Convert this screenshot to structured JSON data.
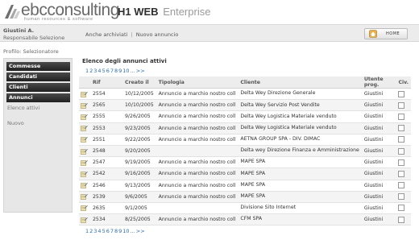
{
  "header": {
    "brand_main": "ebcconsulting",
    "brand_sub": "human resources & software",
    "product_bold": "H1 WEB",
    "product_light": "Enterprise"
  },
  "user": {
    "name": "Giustini A.",
    "role": "Responsabile Selezione"
  },
  "top_links": {
    "archived": "Anche archiviati",
    "separator": "|",
    "new_ad": "Nuovo annuncio"
  },
  "home_button": {
    "label": "HOME"
  },
  "profile": "Profilo: Selezionatore",
  "sidebar": {
    "items": [
      {
        "label": "Commesse"
      },
      {
        "label": "Candidati"
      },
      {
        "label": "Clienti"
      },
      {
        "label": "Annunci"
      }
    ],
    "subitems": [
      {
        "label": "Elenco attivi"
      },
      {
        "label": "Nuovo"
      }
    ]
  },
  "main": {
    "title": "Elenco degli annunci attivi",
    "pager": [
      "1",
      "2",
      "3",
      "4",
      "5",
      "6",
      "7",
      "8",
      "9",
      "10",
      "...",
      ">>"
    ],
    "columns": [
      "Rif",
      "Creato il",
      "Tipologia",
      "Cliente",
      "Utente prog.",
      "Civ."
    ],
    "rows": [
      {
        "rif": "2554",
        "date": "10/12/2005",
        "type": "Annuncio a marchio nostro coll",
        "client": "Delta Wey Direzione Generale",
        "user": "Giustini"
      },
      {
        "rif": "2565",
        "date": "10/10/2005",
        "type": "Annuncio a marchio nostro coll",
        "client": "Delta Wey Servizio Post Vendite",
        "user": "Giustini"
      },
      {
        "rif": "2555",
        "date": "9/26/2005",
        "type": "Annuncio a marchio nostro coll",
        "client": "Delta Wey Logistica Materiale venduto",
        "user": "Giustini"
      },
      {
        "rif": "2553",
        "date": "9/23/2005",
        "type": "Annuncio a marchio nostro coll",
        "client": "Delta Wey Logistica Materiale venduto",
        "user": "Giustini"
      },
      {
        "rif": "2551",
        "date": "9/22/2005",
        "type": "Annuncio a marchio nostro coll",
        "client": "AETNA GROUP SPA - DIV. DIMAC",
        "user": "Giustini"
      },
      {
        "rif": "2548",
        "date": "9/20/2005",
        "type": "",
        "client": "Delta wey Direzione Finanza e Amministrazione",
        "user": "Giustini"
      },
      {
        "rif": "2547",
        "date": "9/19/2005",
        "type": "Annuncio a marchio nostro coll",
        "client": "MAPE SPA",
        "user": "Giustini"
      },
      {
        "rif": "2542",
        "date": "9/16/2005",
        "type": "Annuncio a marchio nostro coll",
        "client": "MAPE SPA",
        "user": "Giustini"
      },
      {
        "rif": "2546",
        "date": "9/13/2005",
        "type": "Annuncio a marchio nostro coll",
        "client": "MAPE SPA",
        "user": "Giustini"
      },
      {
        "rif": "2539",
        "date": "9/6/2005",
        "type": "Annuncio a marchio nostro coll",
        "client": "MAPE SPA",
        "user": "Giustini"
      },
      {
        "rif": "2635",
        "date": "9/1/2005",
        "type": "",
        "client": "Divisione Sito Internet",
        "user": "Giustini"
      },
      {
        "rif": "2534",
        "date": "8/25/2005",
        "type": "Annuncio a marchio nostro coll",
        "client": "CFM SPA",
        "user": "Giustini"
      }
    ]
  },
  "colors": {
    "sidebar_item_bg": "#2a2a2a",
    "link_blue": "#2b6cb0",
    "userbar_bg": "#ececec"
  },
  "icons": {
    "logo": "ebc-logo-icon",
    "home": "home-icon",
    "row": "edit-document-icon"
  }
}
